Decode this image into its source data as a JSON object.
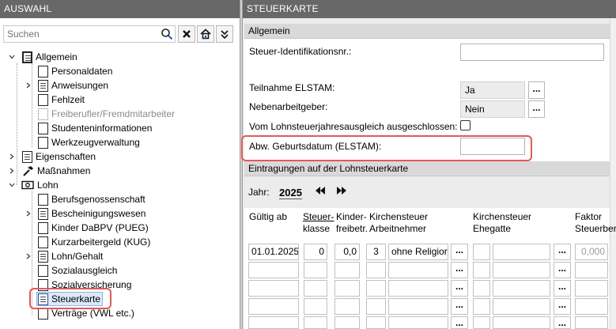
{
  "left_panel": {
    "title": "AUSWAHL",
    "search_placeholder": "Suchen"
  },
  "tree": {
    "items": [
      {
        "label": "Allgemein",
        "level": 0,
        "expanded": true
      },
      {
        "label": "Personaldaten",
        "level": 1
      },
      {
        "label": "Anweisungen",
        "level": 1,
        "expandable": true
      },
      {
        "label": "Fehlzeit",
        "level": 1
      },
      {
        "label": "Freiberufler/Fremdmitarbeiter",
        "level": 1,
        "disabled": true
      },
      {
        "label": "Studenteninformationen",
        "level": 1
      },
      {
        "label": "Werkzeugverwaltung",
        "level": 1
      },
      {
        "label": "Eigenschaften",
        "level": 0
      },
      {
        "label": "Maßnahmen",
        "level": 0
      },
      {
        "label": "Lohn",
        "level": 0,
        "expanded": true
      },
      {
        "label": "Berufsgenossenschaft",
        "level": 1
      },
      {
        "label": "Bescheinigungswesen",
        "level": 1,
        "expandable": true
      },
      {
        "label": "Kinder DaBPV (PUEG)",
        "level": 1
      },
      {
        "label": "Kurzarbeitergeld (KUG)",
        "level": 1
      },
      {
        "label": "Lohn/Gehalt",
        "level": 1,
        "expandable": true
      },
      {
        "label": "Sozialausgleich",
        "level": 1
      },
      {
        "label": "Sozialversicherung",
        "level": 1
      },
      {
        "label": "Steuerkarte",
        "level": 1,
        "selected": true
      },
      {
        "label": "Verträge (VWL etc.)",
        "level": 1
      }
    ]
  },
  "right_panel": {
    "title": "STEUERKARTE",
    "section_general": "Allgemein",
    "fields": {
      "steuer_id_label": "Steuer-Identifikationsnr.:",
      "steuer_id_value": "",
      "elstam_label": "Teilnahme ELSTAM:",
      "elstam_value": "Ja",
      "nebenag_label": "Nebenarbeitgeber:",
      "nebenag_value": "Nein",
      "lsjausgleich_label": "Vom Lohnsteuerjahresausgleich ausgeschlossen:",
      "geburtsdatum_label": "Abw. Geburtsdatum (ELSTAM):",
      "geburtsdatum_value": ""
    },
    "section_entries": "Eintragungen auf der Lohnsteuerkarte",
    "year_label": "Jahr:",
    "year_value": "2025",
    "columns": {
      "gueltig": "Gültig ab",
      "steuer_1": "Steuer-",
      "steuer_2": "klasse",
      "kinder_1": "Kinder-",
      "kinder_2": "freibetr.",
      "kirche_an_1": "Kirchensteuer",
      "kirche_an_2": "Arbeitnehmer",
      "kirche_eg_1": "Kirchensteuer",
      "kirche_eg_2": "Ehegatte",
      "faktor_1": "Faktor",
      "faktor_2": "Steuerber"
    },
    "row1": {
      "gueltig": "01.01.2025",
      "steuerklasse": "0",
      "kinder": "0,0",
      "kirche_code": "3",
      "kirche_text": "ohne Religior",
      "faktor": "0,000"
    },
    "dots_label": "..."
  },
  "colors": {
    "header": "#686868",
    "highlight": "#e05a5a",
    "section": "#d9d9d9"
  }
}
